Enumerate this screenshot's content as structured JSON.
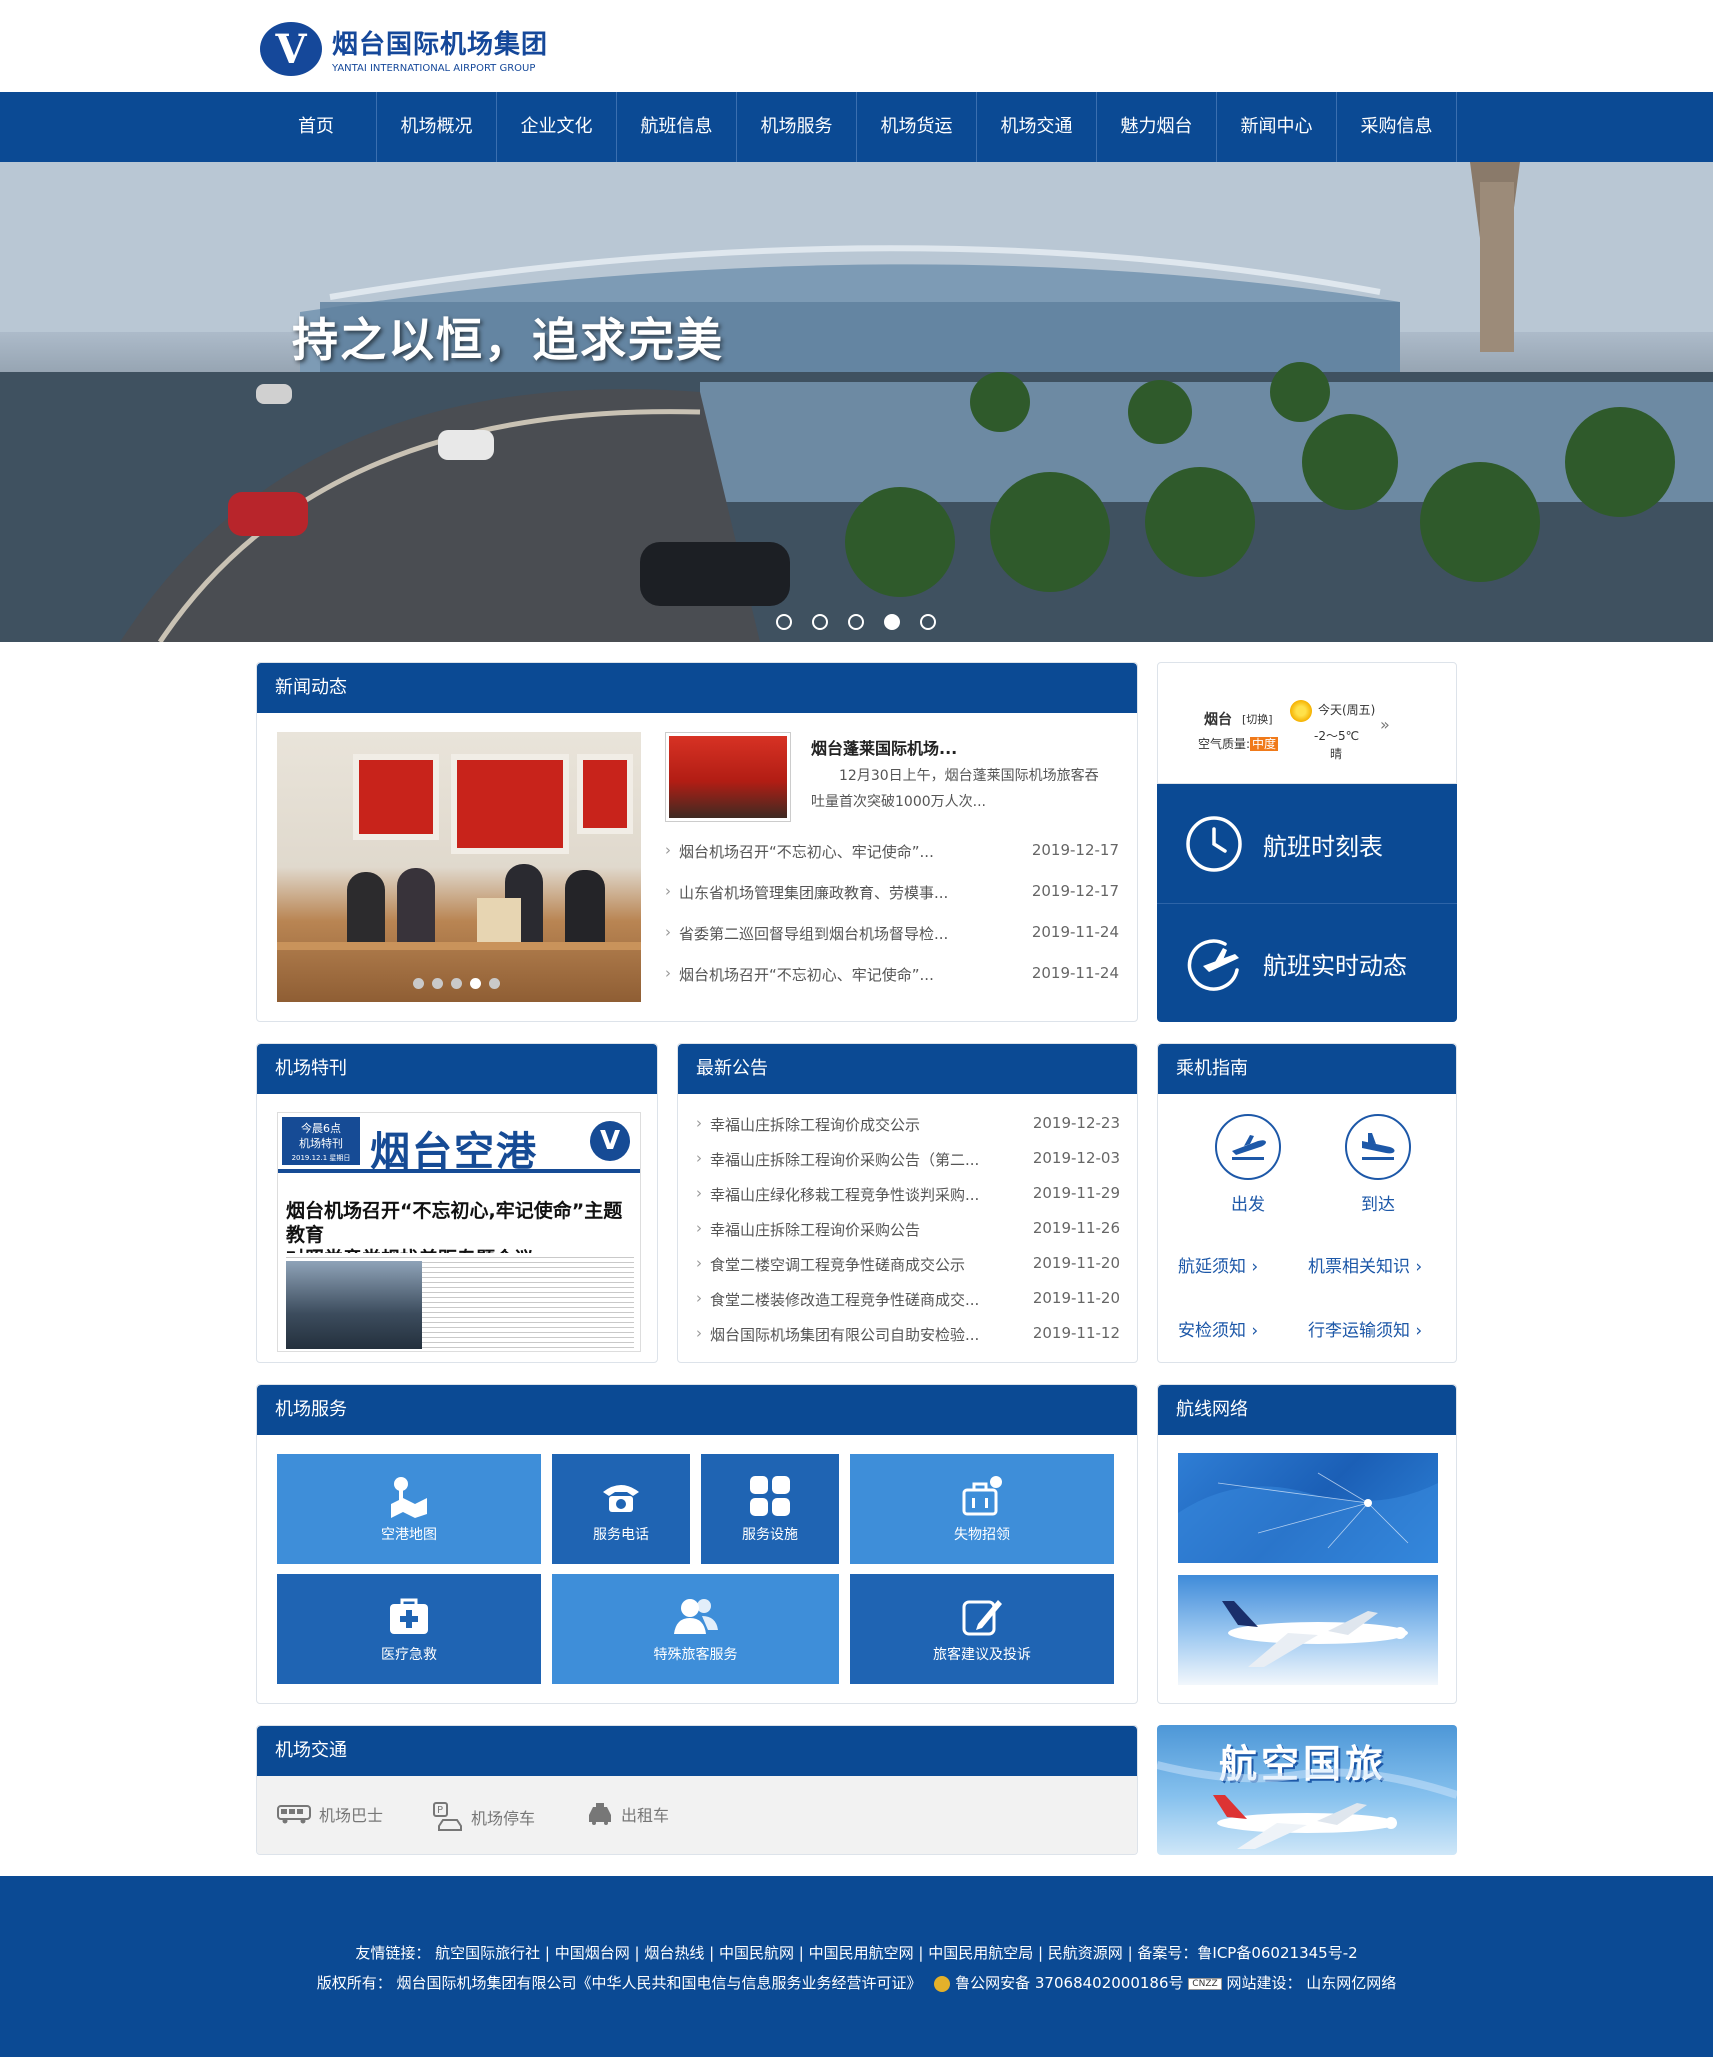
{
  "header": {
    "logo_cn": "烟台国际机场集团",
    "logo_en": "YANTAI INTERNATIONAL AIRPORT GROUP"
  },
  "nav": [
    "首页",
    "机场概况",
    "企业文化",
    "航班信息",
    "机场服务",
    "机场货运",
    "机场交通",
    "魅力烟台",
    "新闻中心",
    "采购信息"
  ],
  "banner": {
    "title": "持之以恒，追求完美",
    "slides": 5,
    "active_slide": 4
  },
  "news": {
    "heading": "新闻动态",
    "image_slides": 5,
    "active_image_slide": 4,
    "featured_title": "烟台蓬莱国际机场...",
    "featured_desc": "12月30日上午，烟台蓬莱国际机场旅客吞吐量首次突破1000万人次...",
    "items": [
      {
        "title": "烟台机场召开“不忘初心、牢记使命”...",
        "date": "2019-12-17"
      },
      {
        "title": "山东省机场管理集团廉政教育、劳模事...",
        "date": "2019-12-17"
      },
      {
        "title": "省委第二巡回督导组到烟台机场督导检...",
        "date": "2019-11-24"
      },
      {
        "title": "烟台机场召开“不忘初心、牢记使命”...",
        "date": "2019-11-24"
      }
    ]
  },
  "weather": {
    "city": "烟台",
    "switch": "[切换]",
    "air_label": "空气质量:",
    "air_value": "中度",
    "day": "今天(周五)",
    "temp": "-2～5℃",
    "condition": "晴",
    "more": "»"
  },
  "flight": {
    "schedule": "航班时刻表",
    "dynamic": "航班实时动态"
  },
  "magazine": {
    "heading": "机场特刊",
    "badge_line1": "今晨6点",
    "badge_line2": "机场特刊",
    "badge_line3": "2019.12.1 星期日",
    "name": "烟台空港",
    "headline_1": "烟台机场召开“不忘初心,牢记使命”主题教育",
    "headline_2": "对照党章党规找差距专题会议"
  },
  "notice": {
    "heading": "最新公告",
    "items": [
      {
        "title": "幸福山庄拆除工程询价成交公示",
        "date": "2019-12-23"
      },
      {
        "title": "幸福山庄拆除工程询价采购公告（第二...",
        "date": "2019-12-03"
      },
      {
        "title": "幸福山庄绿化移栽工程竞争性谈判采购...",
        "date": "2019-11-29"
      },
      {
        "title": "幸福山庄拆除工程询价采购公告",
        "date": "2019-11-26"
      },
      {
        "title": "食堂二楼空调工程竞争性磋商成交公示",
        "date": "2019-11-20"
      },
      {
        "title": "食堂二楼装修改造工程竞争性磋商成交...",
        "date": "2019-11-20"
      },
      {
        "title": "烟台国际机场集团有限公司自助安检验...",
        "date": "2019-11-12"
      }
    ]
  },
  "guide": {
    "heading": "乘机指南",
    "depart": "出发",
    "arrive": "到达",
    "links": [
      "航延须知",
      "机票相关知识",
      "安检须知",
      "行李运输须知"
    ]
  },
  "services": {
    "heading": "机场服务",
    "tiles": [
      "空港地图",
      "服务电话",
      "服务设施",
      "失物招领",
      "医疗急救",
      "特殊旅客服务",
      "旅客建议及投诉"
    ],
    "colors": {
      "light": "#3e8ed9",
      "dark": "#1f64b3"
    }
  },
  "routes": {
    "heading": "航线网络"
  },
  "travel": {
    "title": "航空国旅"
  },
  "transport": {
    "heading": "机场交通",
    "items": [
      "机场巴士",
      "机场停车",
      "出租车"
    ]
  },
  "footer": {
    "links_label": "友情链接：",
    "links": [
      "航空国际旅行社",
      "中国烟台网",
      "烟台热线",
      "中国民航网",
      "中国民用航空网",
      "中国民用航空局",
      "民航资源网"
    ],
    "icp": "备案号：鲁ICP备06021345号-2",
    "copyright": "版权所有：  烟台国际机场集团有限公司《中华人民共和国电信与信息服务业务经营许可证》",
    "police": "鲁公网安备 37068402000186号",
    "cnzz": "CNZZ",
    "builder": "网站建设：  山东网亿网络"
  },
  "colors": {
    "primary": "#0b4a94",
    "link": "#1d58a8",
    "footer": "#0b4a94"
  }
}
